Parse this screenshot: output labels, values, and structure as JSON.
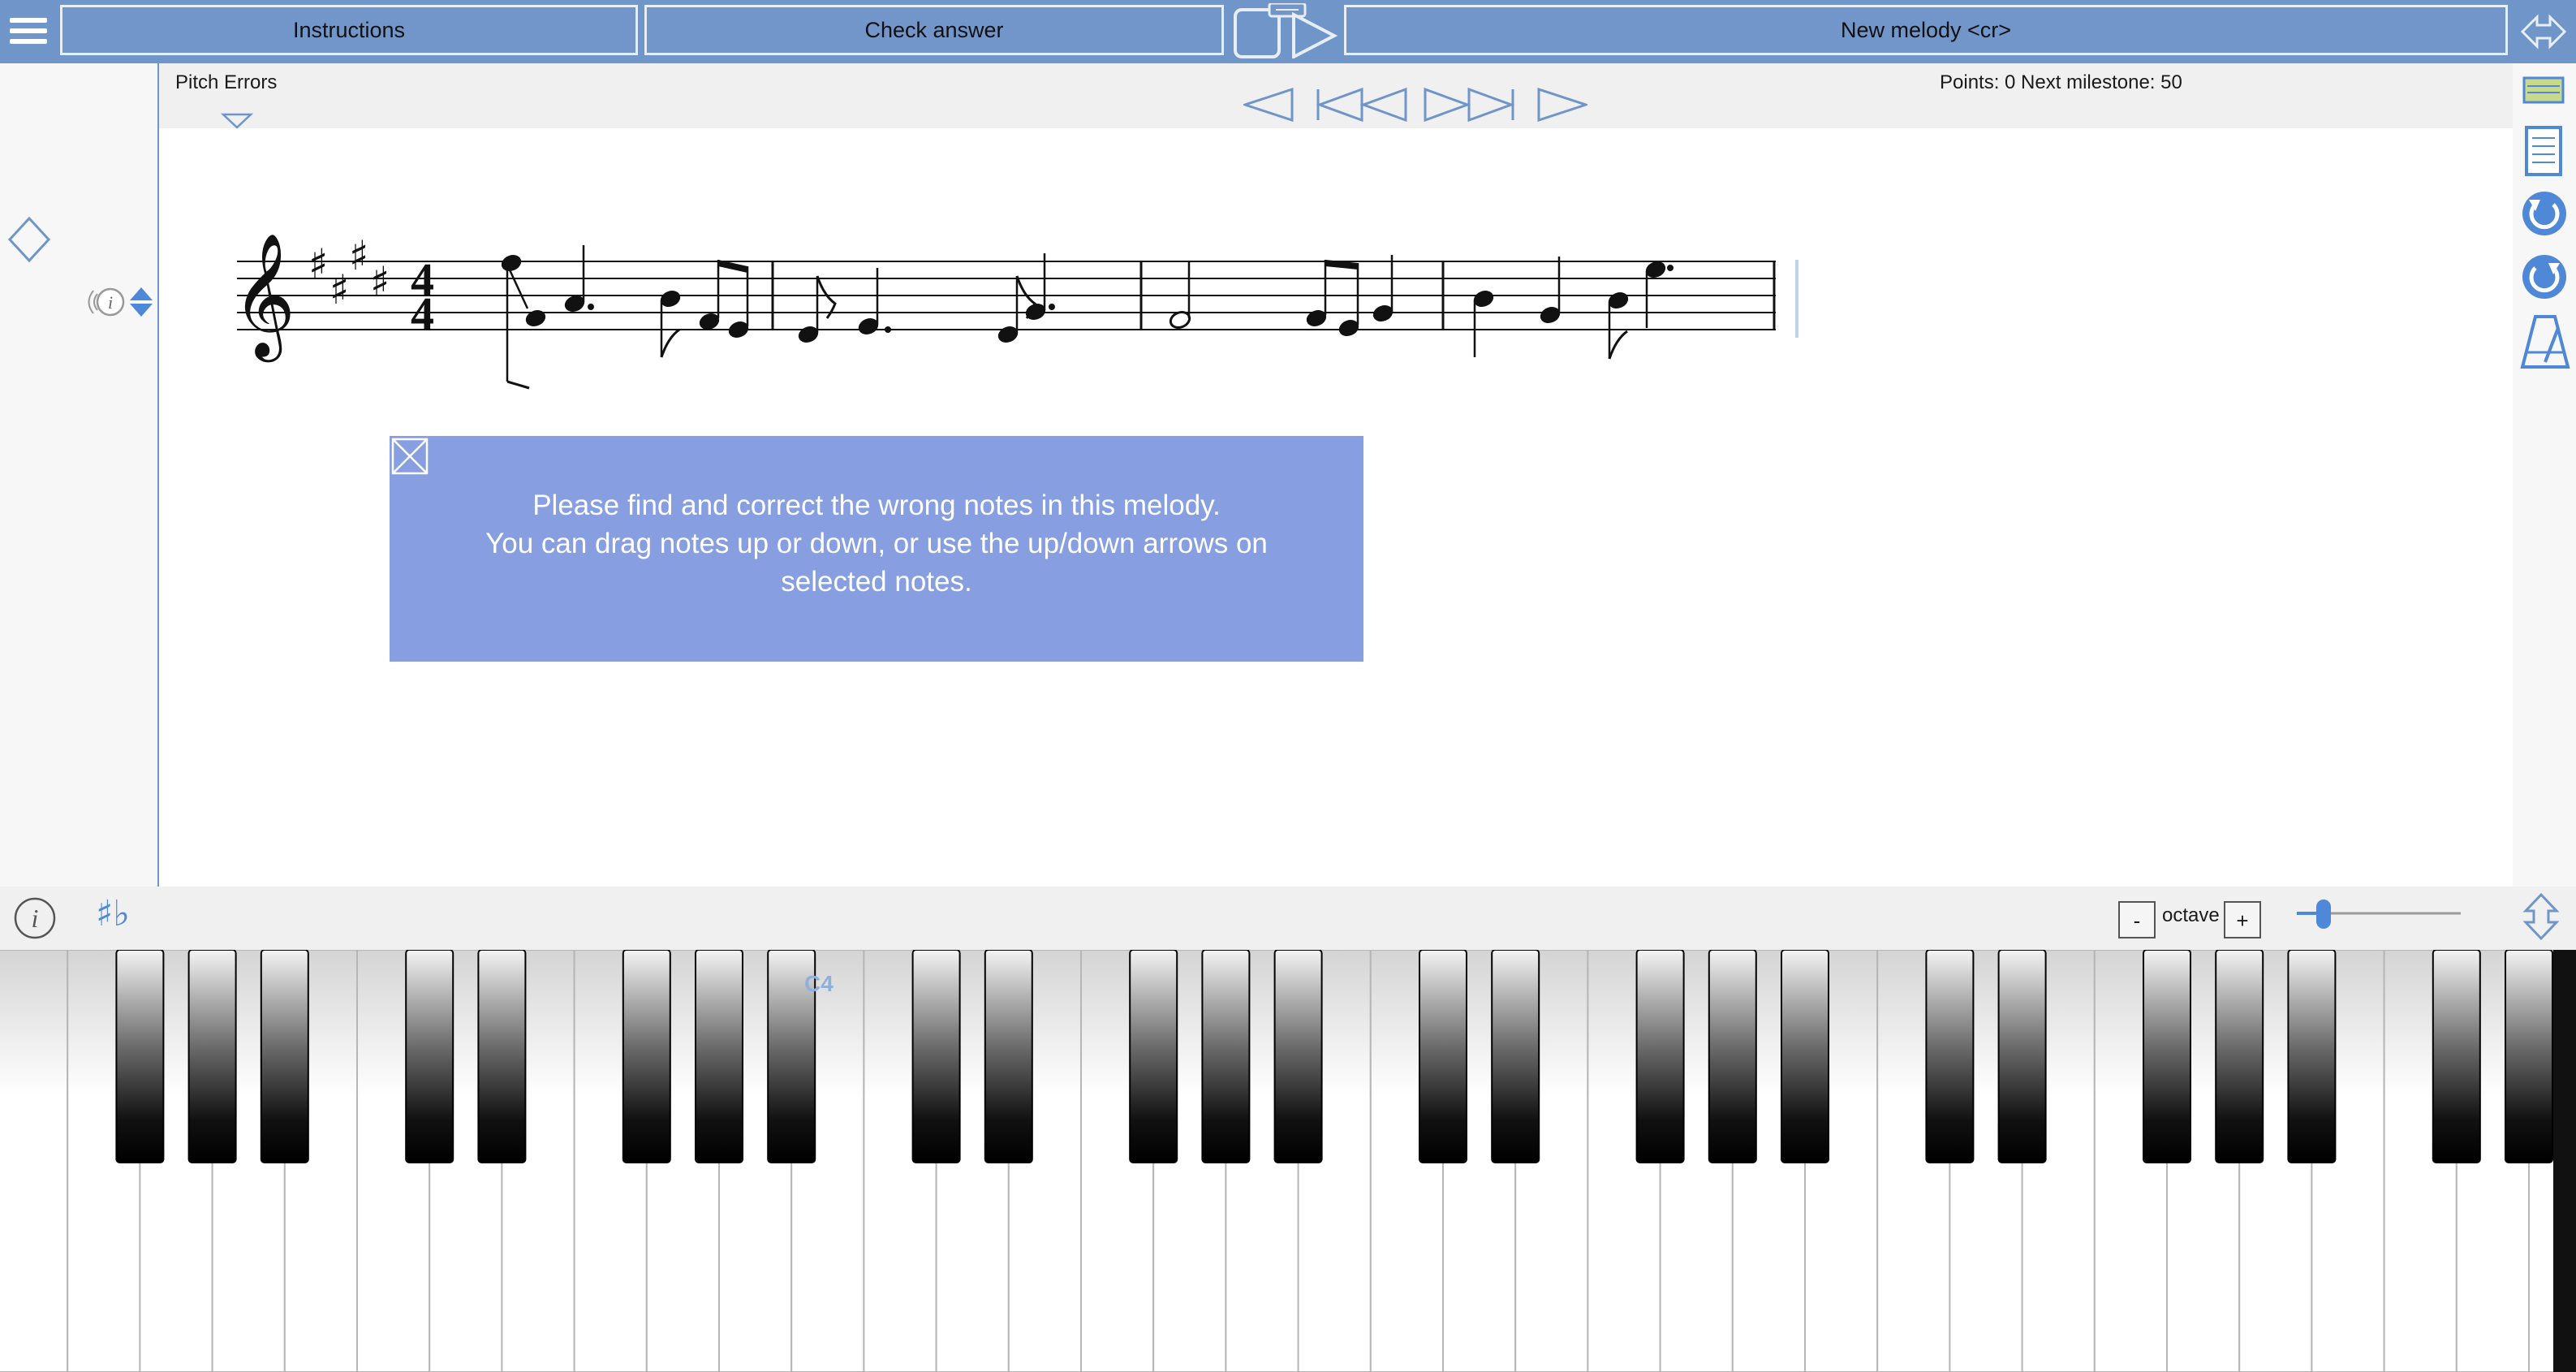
{
  "toolbar": {
    "instructions_label": "Instructions",
    "check_answer_label": "Check answer",
    "new_melody_label": "New melody <cr>"
  },
  "header": {
    "mode_label": "Pitch Errors",
    "points_label": "Points: 0 Next milestone: 50"
  },
  "score": {
    "clef": "treble",
    "key_signature_sharps": 4,
    "time_signature": "4/4",
    "measure_count": 4
  },
  "popup": {
    "line1": "Please find and correct the wrong notes in this melody.",
    "line2": "You can drag notes up or down, or use the up/down arrows on",
    "line3": "selected notes."
  },
  "keyboard": {
    "octave_minus": "-",
    "octave_label": "octave",
    "octave_plus": "+",
    "c4_label": "C4",
    "accidentals_label": "♯♭"
  },
  "colors": {
    "accent": "#6f95c9",
    "popup": "#879fe0",
    "icon_blue": "#4f88d6"
  }
}
